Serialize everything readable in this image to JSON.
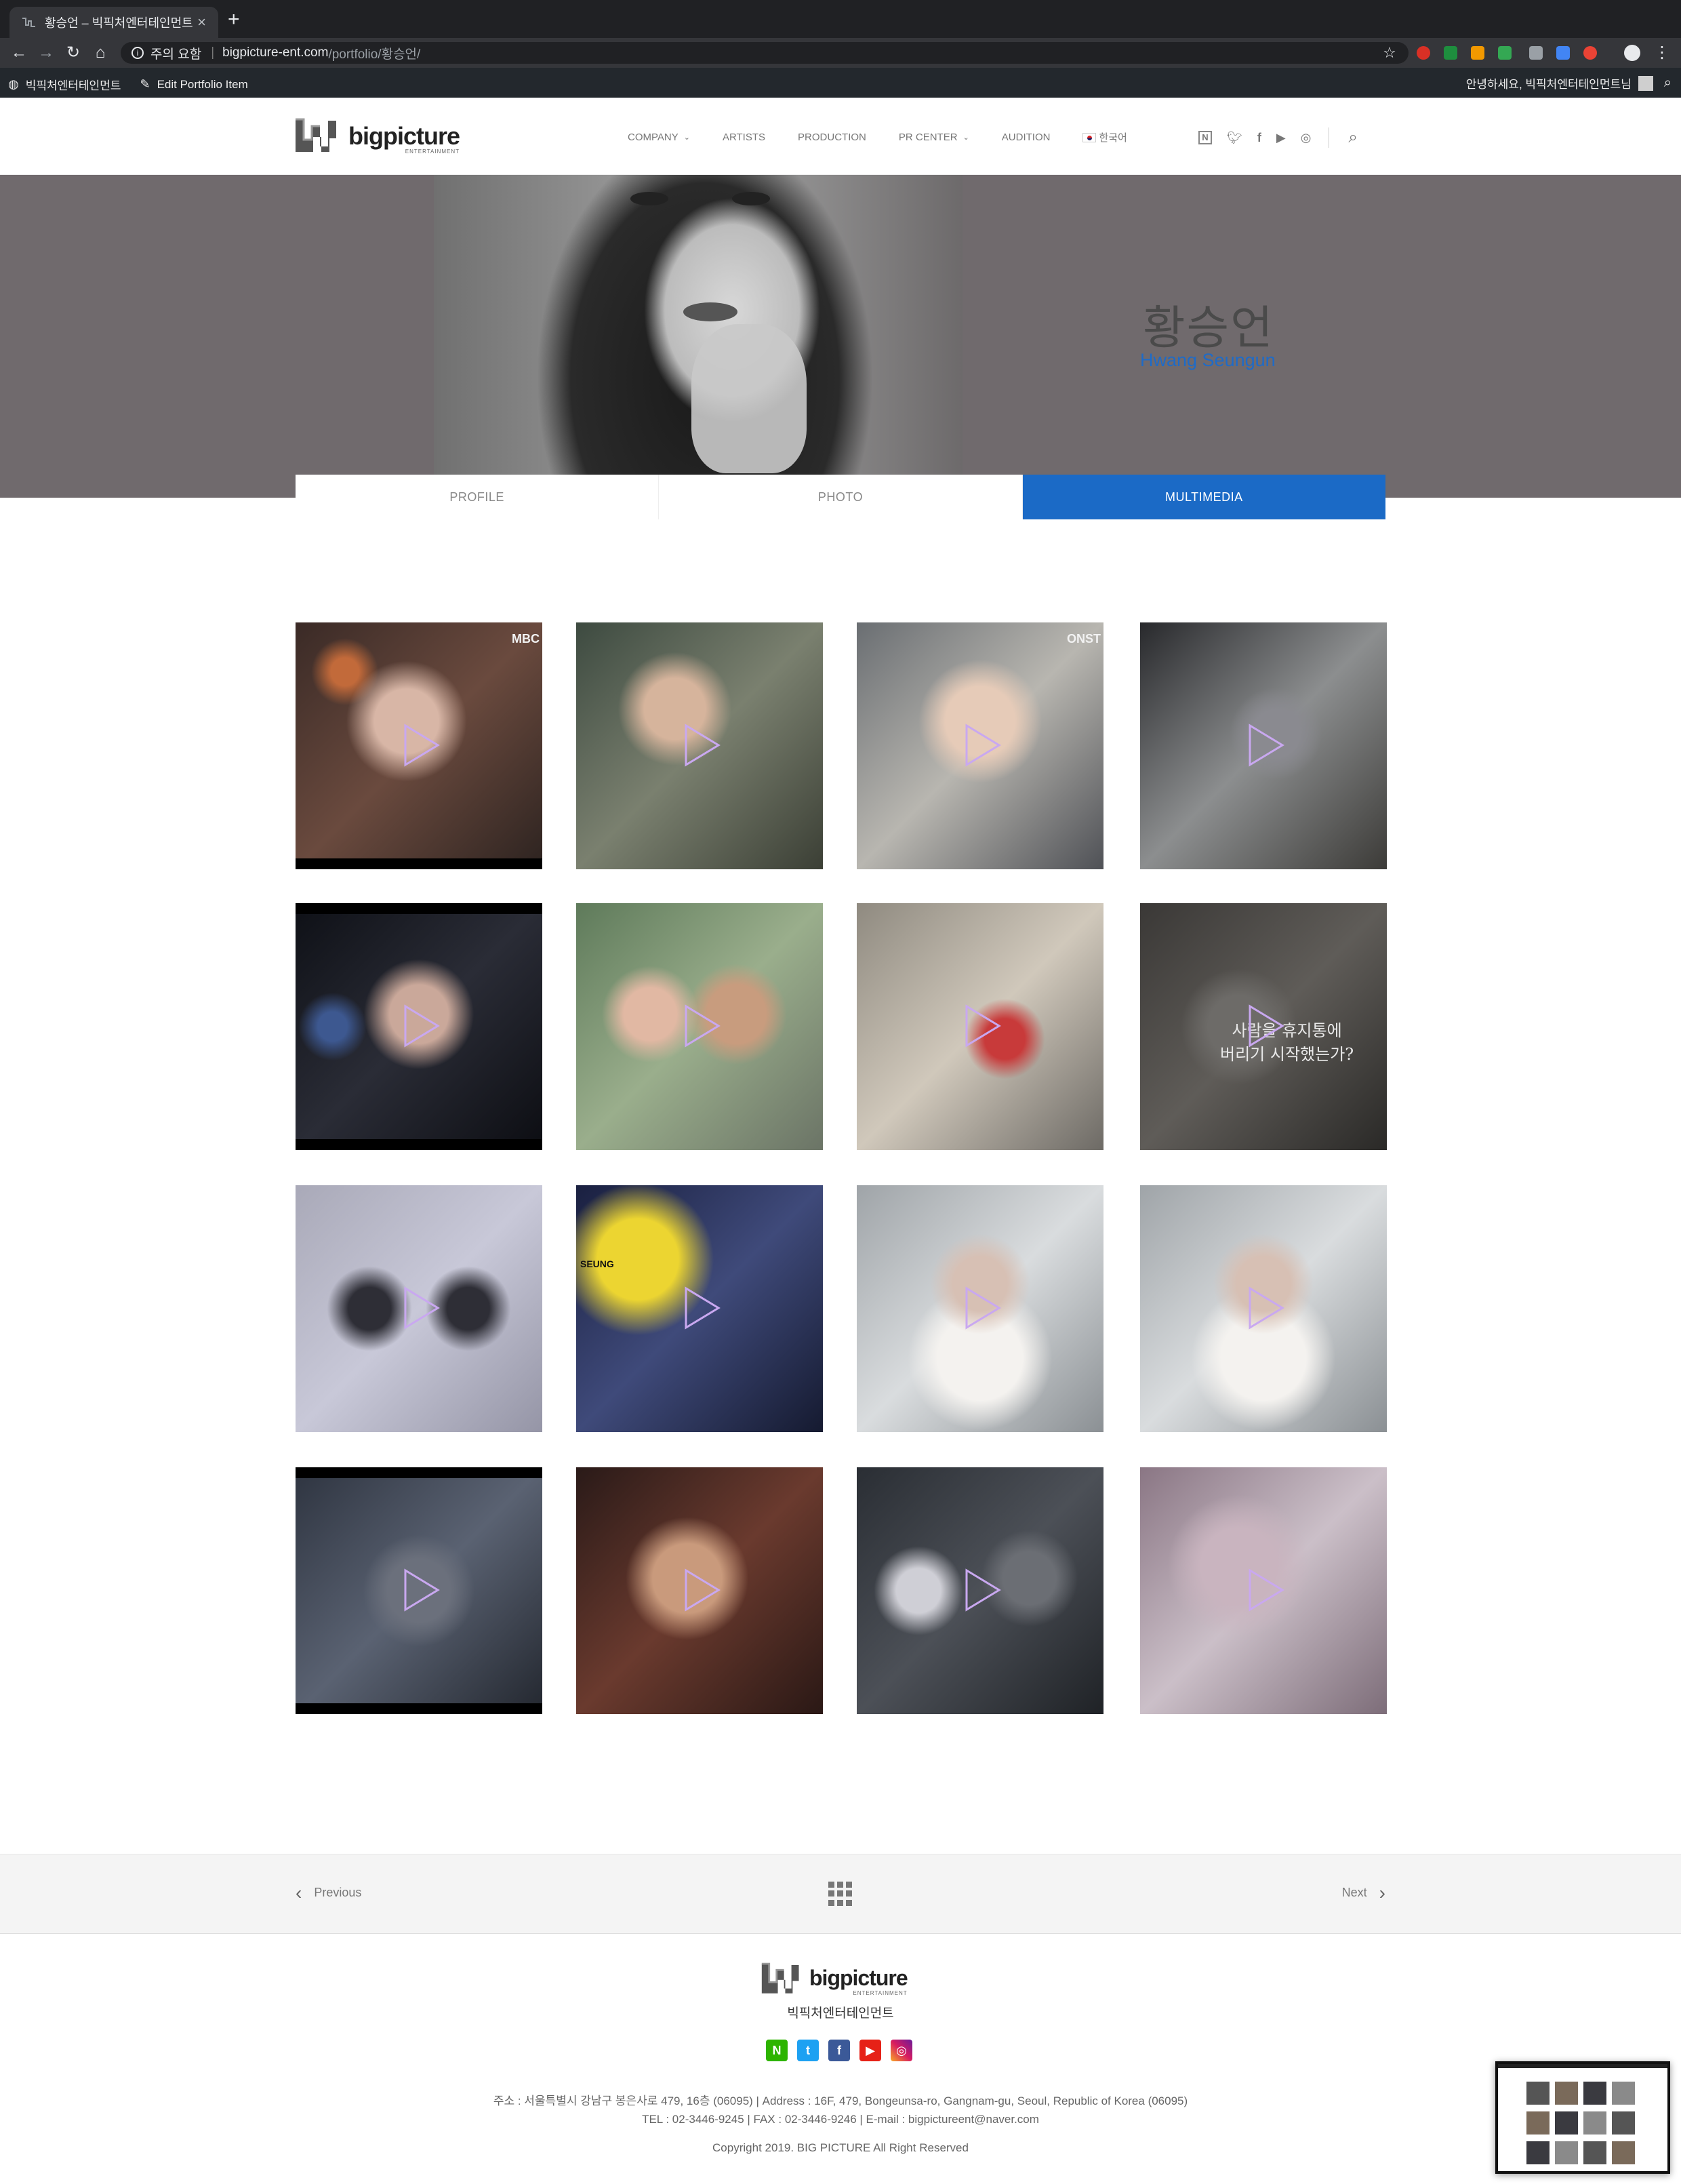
{
  "browser": {
    "tab_title": "황승언 – 빅픽처엔터테인먼트",
    "security_label": "주의 요함",
    "url_host": "bigpicture-ent.com",
    "url_path": "/portfolio/황승언/"
  },
  "wpbar": {
    "site_name": "빅픽처엔터테인먼트",
    "edit_label": "Edit Portfolio Item",
    "greeting": "안녕하세요, 빅픽처엔터테인먼트님"
  },
  "header": {
    "logo_text": "bigpicture",
    "logo_sub": "ENTERTAINMENT",
    "nav": [
      {
        "label": "COMPANY",
        "has_dropdown": true
      },
      {
        "label": "ARTISTS",
        "has_dropdown": false
      },
      {
        "label": "PRODUCTION",
        "has_dropdown": false
      },
      {
        "label": "PR CENTER",
        "has_dropdown": true
      },
      {
        "label": "AUDITION",
        "has_dropdown": false
      },
      {
        "label": "한국어",
        "has_dropdown": false
      }
    ],
    "social_icons": [
      "naver-icon",
      "twitter-icon",
      "facebook-icon",
      "youtube-icon",
      "instagram-icon"
    ]
  },
  "hero": {
    "name_ko": "황승언",
    "name_en": "Hwang Seungun"
  },
  "tabs": [
    {
      "label": "PROFILE",
      "active": false
    },
    {
      "label": "PHOTO",
      "active": false
    },
    {
      "label": "MULTIMEDIA",
      "active": true
    }
  ],
  "videos": [
    {
      "overlay_text": "MBC"
    },
    {
      "overlay_text": ""
    },
    {
      "overlay_text": "ONST"
    },
    {
      "overlay_text": ""
    },
    {
      "overlay_text": ""
    },
    {
      "overlay_text": ""
    },
    {
      "overlay_text": ""
    },
    {
      "overlay_text": "사람을 휴지통에\n버리기 시작했는가?"
    },
    {
      "overlay_text": ""
    },
    {
      "overlay_text": "SEUNG"
    },
    {
      "overlay_text": ""
    },
    {
      "overlay_text": ""
    },
    {
      "overlay_text": ""
    },
    {
      "overlay_text": ""
    },
    {
      "overlay_text": ""
    },
    {
      "overlay_text": ""
    }
  ],
  "pagination": {
    "prev_label": "Previous",
    "next_label": "Next"
  },
  "footer": {
    "company_name": "빅픽처엔터테인먼트",
    "address": "주소 : 서울특별시 강남구 봉은사로 479, 16층 (06095) | Address : 16F, 479, Bongeunsa-ro, Gangnam-gu, Seoul, Republic of Korea (06095)",
    "contact": "TEL : 02-3446-9245 | FAX : 02-3446-9246 | E-mail : bigpictureent@naver.com",
    "copyright": "Copyright 2019. BIG PICTURE All Right Reserved"
  },
  "colors": {
    "accent": "#1b6ac6",
    "hero_bg": "#706a6d",
    "play_icon": "#c9a8f0"
  }
}
